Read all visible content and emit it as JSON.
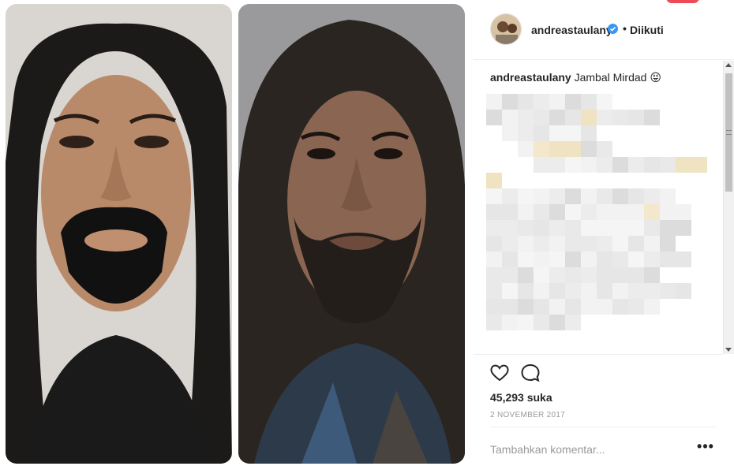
{
  "post": {
    "username": "andreastaulany",
    "follow_status": "Diikuti",
    "dot": "•",
    "caption_username": "andreastaulany",
    "caption_text": "Jambal Mirdad 😝",
    "likes_text": "45,293 suka",
    "date": "2 NOVEMBER 2017",
    "comment_placeholder": "Tambahkan komentar...",
    "more_label": "•••"
  },
  "media": {
    "left_photo": "photo-man-with-wig-and-fake-beard",
    "right_photo": "photo-long-haired-bearded-man"
  },
  "icons": {
    "verified": "verified-badge-icon",
    "like": "heart-outline-icon",
    "comment": "speech-bubble-icon",
    "more": "ellipsis-icon"
  },
  "colors": {
    "text": "#262626",
    "muted": "#999999",
    "verified": "#3897f0",
    "notification": "#ed4956",
    "divider": "#efefef"
  }
}
